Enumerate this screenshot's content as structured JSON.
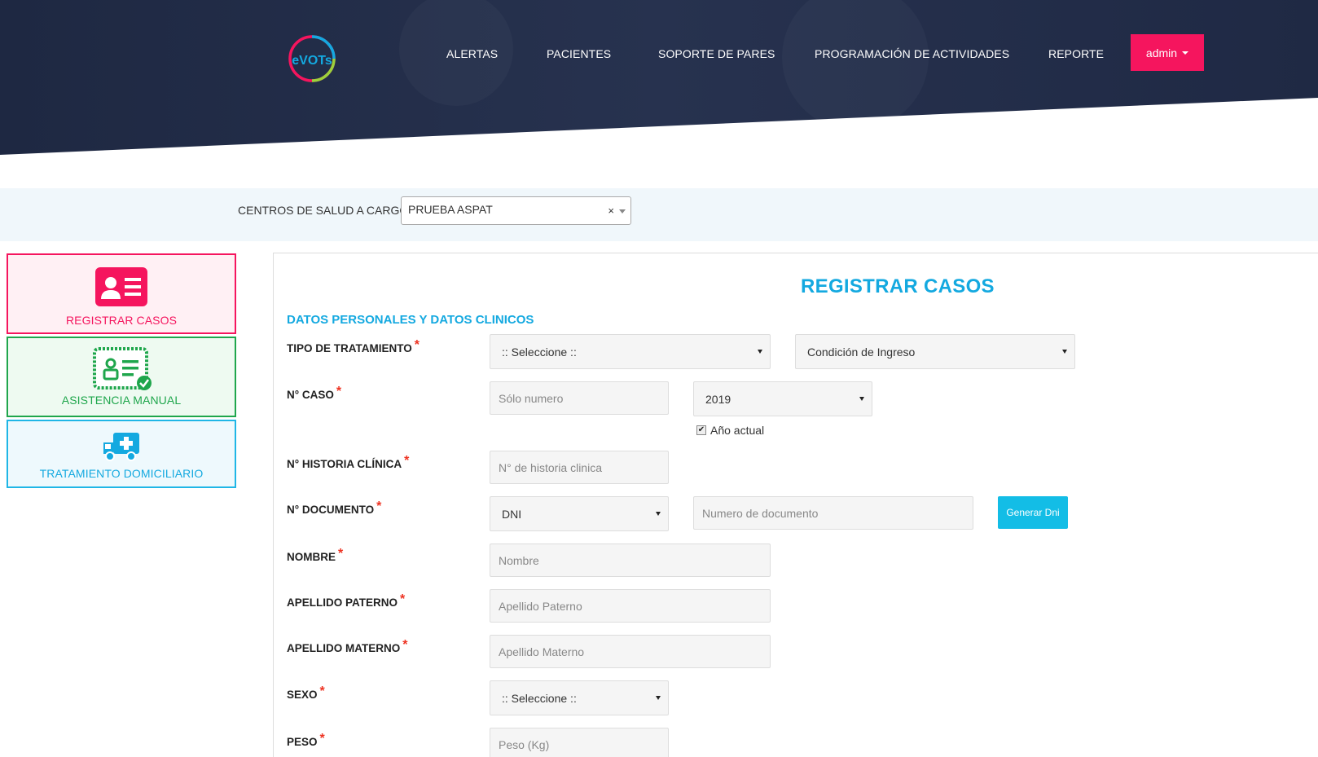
{
  "header": {
    "logo_text": "eVOTs",
    "nav": [
      {
        "label": "ALERTAS"
      },
      {
        "label": "PACIENTES"
      },
      {
        "label": "SOPORTE DE PARES"
      },
      {
        "label": "PROGRAMACIÓN DE ACTIVIDADES"
      },
      {
        "label": "REPORTE"
      }
    ],
    "user_menu_label": "admin"
  },
  "centers": {
    "label": "CENTROS DE SALUD A CARGO :",
    "selected": "PRUEBA ASPAT",
    "clear_symbol": "×"
  },
  "sidebar": {
    "items": [
      {
        "label": "REGISTRAR CASOS",
        "icon": "id-card-icon",
        "color": "#f5155e"
      },
      {
        "label": "ASISTENCIA MANUAL",
        "icon": "id-card-check-icon",
        "color": "#1fa64c"
      },
      {
        "label": "TRATAMIENTO DOMICILIARIO",
        "icon": "ambulance-icon",
        "color": "#14a9e0"
      }
    ]
  },
  "form": {
    "title": "REGISTRAR CASOS",
    "section": "DATOS PERSONALES Y DATOS CLINICOS",
    "required_mark": "*",
    "labels": {
      "tipo_tratamiento": "TIPO DE TRATAMIENTO",
      "caso": "N° CASO",
      "historia": "N° HISTORIA CLÍNICA",
      "documento": "N° DOCUMENTO",
      "nombre": "NOMBRE",
      "apellido_paterno": "APELLIDO PATERNO",
      "apellido_materno": "APELLIDO MATERNO",
      "sexo": "SEXO",
      "peso": "PESO"
    },
    "fields": {
      "tipo_tratamiento_value": ":: Seleccione ::",
      "condicion_value": "Condición de Ingreso",
      "caso_placeholder": "Sólo numero",
      "anio_value": "2019",
      "anio_actual_label": "Año actual",
      "anio_actual_checked": true,
      "historia_placeholder": "N° de historia clinica",
      "doc_tipo_value": "DNI",
      "doc_numero_placeholder": "Numero de documento",
      "generar_dni_label": "Generar Dni",
      "nombre_placeholder": "Nombre",
      "apellido_paterno_placeholder": "Apellido Paterno",
      "apellido_materno_placeholder": "Apellido Materno",
      "sexo_value": ":: Seleccione ::",
      "peso_placeholder": "Peso (Kg)"
    }
  },
  "colors": {
    "header_bg": "#1f2a45",
    "accent_pink": "#f5155e",
    "accent_blue": "#14a9e0",
    "accent_green": "#1fa64c",
    "button_cyan": "#13bde6"
  }
}
